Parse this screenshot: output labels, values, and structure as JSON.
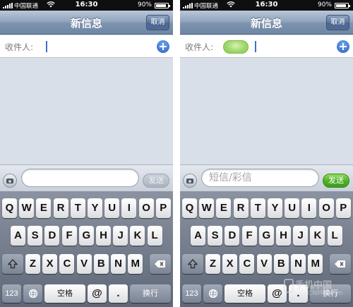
{
  "screens": [
    {
      "status": {
        "carrier": "中国联通",
        "time": "16:30",
        "battery": "90%",
        "battery_level": 0.9
      },
      "nav": {
        "title": "新信息",
        "cancel": "取消"
      },
      "recipient": {
        "label": "收件人:",
        "value": ""
      },
      "compose": {
        "placeholder": "",
        "send": "发送",
        "send_enabled": false
      },
      "keyboard": {
        "row1": [
          "Q",
          "W",
          "E",
          "R",
          "T",
          "Y",
          "U",
          "I",
          "O",
          "P"
        ],
        "row2": [
          "A",
          "S",
          "D",
          "F",
          "G",
          "H",
          "J",
          "K",
          "L"
        ],
        "row3": [
          "Z",
          "X",
          "C",
          "V",
          "B",
          "N",
          "M"
        ],
        "numbers": "123",
        "space": "空格",
        "at": "@",
        "dot": ".",
        "return": "换行"
      }
    },
    {
      "status": {
        "carrier": "中国联通",
        "time": "16:30",
        "battery": "90%",
        "battery_level": 0.9
      },
      "nav": {
        "title": "新信息",
        "cancel": "取消"
      },
      "recipient": {
        "label": "收件人:",
        "value": ""
      },
      "compose": {
        "placeholder": "短信/彩信",
        "send": "发送",
        "send_enabled": true
      },
      "keyboard": {
        "row1": [
          "Q",
          "W",
          "E",
          "R",
          "T",
          "Y",
          "U",
          "I",
          "O",
          "P"
        ],
        "row2": [
          "A",
          "S",
          "D",
          "F",
          "G",
          "H",
          "J",
          "K",
          "L"
        ],
        "row3": [
          "Z",
          "X",
          "C",
          "V",
          "B",
          "N",
          "M"
        ],
        "numbers": "123",
        "space": "空格",
        "at": "@",
        "dot": ".",
        "return": "换行"
      }
    }
  ],
  "watermark": {
    "main": "手机中国",
    "sub": "CNMO.com"
  },
  "colors": {
    "nav": "#7e94b0",
    "send_active": "#4fae26",
    "chip": "#9fd66b",
    "cursor": "#3b6fd8"
  }
}
